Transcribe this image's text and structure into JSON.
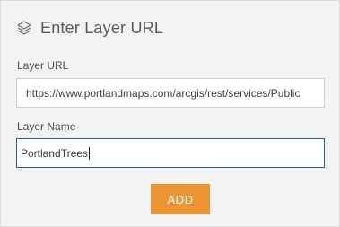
{
  "header": {
    "icon": "layers-icon",
    "title": "Enter Layer URL"
  },
  "form": {
    "url_label": "Layer URL",
    "url_value": "https://www.portlandmaps.com/arcgis/rest/services/Public",
    "name_label": "Layer Name",
    "name_value": "PortlandTrees"
  },
  "actions": {
    "add_label": "ADD"
  },
  "colors": {
    "accent": "#ed9433",
    "focus_border": "#2f5e8a",
    "panel_bg": "#f3f3f3"
  }
}
